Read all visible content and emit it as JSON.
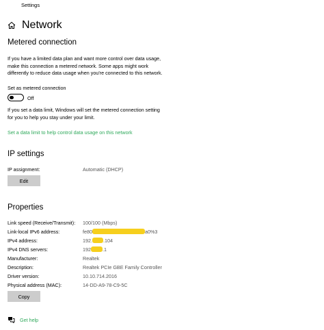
{
  "window": {
    "title": "Settings"
  },
  "page": {
    "title": "Network"
  },
  "metered": {
    "heading": "Metered connection",
    "desc_lines": [
      "If you have a limited data plan and want more control over data usage,",
      "make this connection a metered network. Some apps might work",
      "differently to reduce data usage when you're connected to this network."
    ],
    "toggle_label": "Set as metered connection",
    "toggle_state": "Off",
    "limit_lines": [
      "If you set a data limit, Windows will set the metered connection setting",
      "for you to help you stay under your limit."
    ],
    "limit_link": "Set a data limit to help control data usage on this network"
  },
  "ip": {
    "heading": "IP settings",
    "assignment_key": "IP assignment:",
    "assignment_value": "Automatic (DHCP)",
    "edit_label": "Edit"
  },
  "properties": {
    "heading": "Properties",
    "rows": [
      {
        "key": "Link speed (Receive/Transmit):",
        "value": "100/100 (Mbps)"
      },
      {
        "key": "Link-local IPv6 address:",
        "value_start": "fe80",
        "value_end": "a0%3"
      },
      {
        "key": "IPv4 address:",
        "value_start": "192.",
        "value_end": ".104"
      },
      {
        "key": "IPv4 DNS servers:",
        "value_start": "192",
        "value_end": ".1"
      },
      {
        "key": "Manufacturer:",
        "value": "Realtek"
      },
      {
        "key": "Description:",
        "value": "Realtek PCIe GBE Family Controller"
      },
      {
        "key": "Driver version:",
        "value": "10.10.714.2016"
      },
      {
        "key": "Physical address (MAC):",
        "value": "14-DD-A9-78-C9-5C"
      }
    ],
    "copy_label": "Copy"
  },
  "help": {
    "label": "Get help"
  },
  "colors": {
    "link": "#2fa95b",
    "button": "#cccccc",
    "redaction": "#f6cf1d"
  }
}
